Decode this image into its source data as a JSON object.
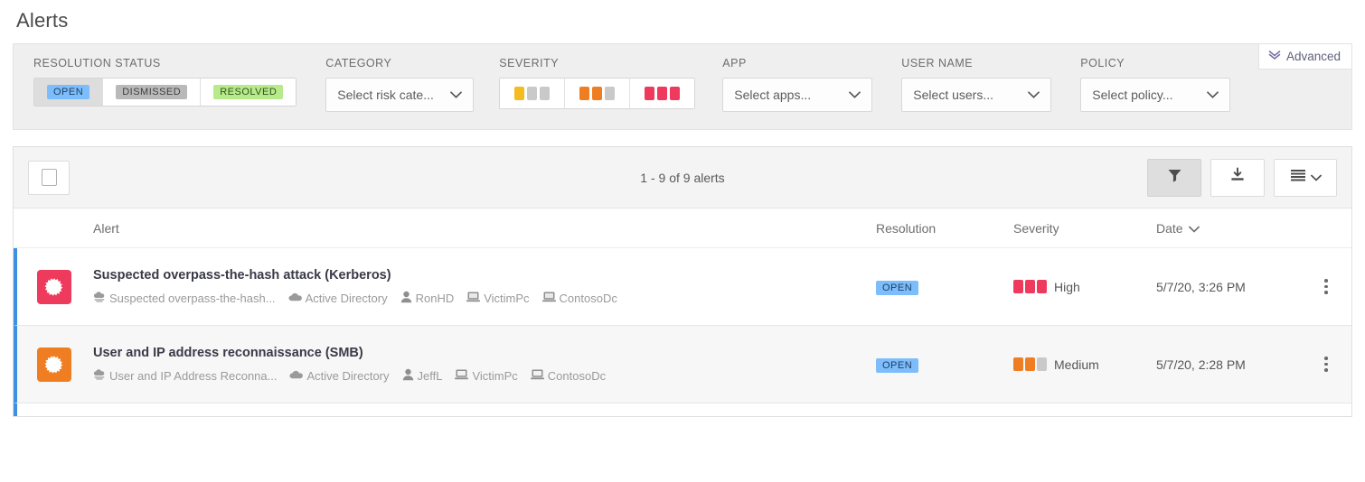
{
  "page": {
    "title": "Alerts"
  },
  "filters": {
    "advanced_label": "Advanced",
    "resolution": {
      "label": "RESOLUTION STATUS",
      "options": [
        {
          "label": "OPEN",
          "selected": true
        },
        {
          "label": "DISMISSED",
          "selected": false
        },
        {
          "label": "RESOLVED",
          "selected": false
        }
      ]
    },
    "category": {
      "label": "CATEGORY",
      "placeholder": "Select risk cate..."
    },
    "severity": {
      "label": "SEVERITY",
      "options": [
        {
          "name": "low",
          "filled": 1,
          "color": "#f5bc21"
        },
        {
          "name": "medium",
          "filled": 2,
          "color": "#ef7e22"
        },
        {
          "name": "high",
          "filled": 3,
          "color": "#ee3a5c"
        }
      ],
      "empty_color": "#c9c9c9"
    },
    "app": {
      "label": "APP",
      "placeholder": "Select apps..."
    },
    "user_name": {
      "label": "USER NAME",
      "placeholder": "Select users..."
    },
    "policy": {
      "label": "POLICY",
      "placeholder": "Select policy..."
    }
  },
  "table": {
    "count_text": "1 - 9 of 9 alerts",
    "columns": {
      "alert": "Alert",
      "resolution": "Resolution",
      "severity": "Severity",
      "date": "Date"
    },
    "rows": [
      {
        "icon_color": "#ee3a5c",
        "title": "Suspected overpass-the-hash attack (Kerberos)",
        "meta": [
          {
            "icon": "policy-icon",
            "text": "Suspected overpass-the-hash..."
          },
          {
            "icon": "cloud-icon",
            "text": "Active Directory"
          },
          {
            "icon": "user-icon",
            "text": "RonHD"
          },
          {
            "icon": "device-icon",
            "text": "VictimPc"
          },
          {
            "icon": "device-icon",
            "text": "ContosoDc"
          }
        ],
        "resolution": "OPEN",
        "severity_label": "High",
        "severity_filled": 3,
        "severity_color": "#ee3a5c",
        "date": "5/7/20, 3:26 PM"
      },
      {
        "icon_color": "#ef7e22",
        "title": "User and IP address reconnaissance (SMB)",
        "meta": [
          {
            "icon": "policy-icon",
            "text": "User and IP Address Reconna..."
          },
          {
            "icon": "cloud-icon",
            "text": "Active Directory"
          },
          {
            "icon": "user-icon",
            "text": "JeffL"
          },
          {
            "icon": "device-icon",
            "text": "VictimPc"
          },
          {
            "icon": "device-icon",
            "text": "ContosoDc"
          }
        ],
        "resolution": "OPEN",
        "severity_label": "Medium",
        "severity_filled": 2,
        "severity_color": "#ef7e22",
        "date": "5/7/20, 2:28 PM"
      }
    ]
  },
  "colors": {
    "accent_blue": "#3f8fe3",
    "badge_open_bg": "#7dbdfc",
    "severity_empty": "#c9c9c9"
  }
}
